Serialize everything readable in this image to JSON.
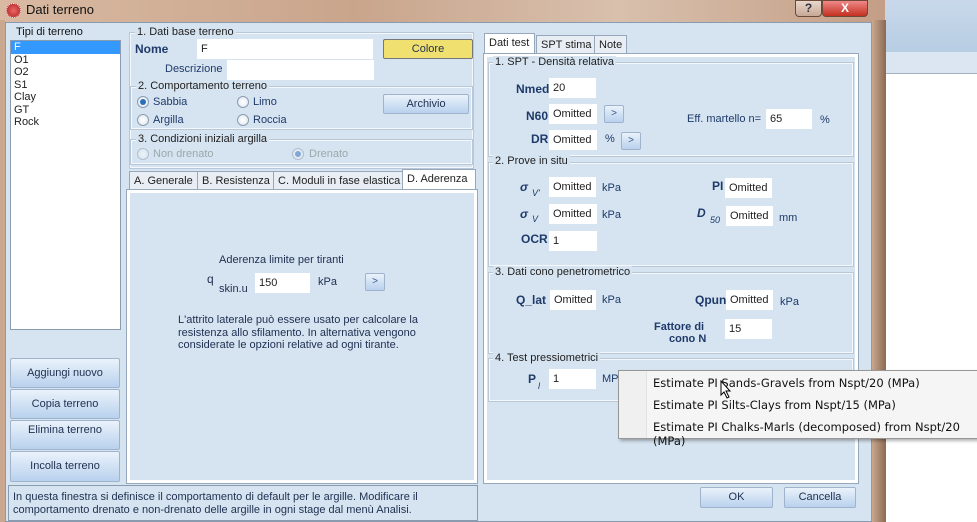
{
  "window": {
    "title": "Dati terreno",
    "help_label": "?",
    "close_label": "X"
  },
  "soil_list": {
    "title": "Tipi di terreno",
    "items": [
      "F",
      "O1",
      "O2",
      "S1",
      "Clay",
      "GT",
      "Rock"
    ],
    "selected": "F"
  },
  "left_buttons": {
    "add": "Aggiungi nuovo",
    "copy": "Copia terreno",
    "delete": "Elimina terreno",
    "paste": "Incolla terreno"
  },
  "base": {
    "title": "1. Dati base terreno",
    "name_label": "Nome",
    "name_value": "F",
    "desc_label": "Descrizione",
    "desc_value": "",
    "color_button": "Colore",
    "color_value": "#f0e070"
  },
  "behavior": {
    "title": "2. Comportamento terreno",
    "options": [
      "Sabbia",
      "Limo",
      "Argilla",
      "Roccia"
    ],
    "selected": "Sabbia",
    "archive_button": "Archivio"
  },
  "clay": {
    "title": "3. Condizioni iniziali argilla",
    "options": [
      "Non drenato",
      "Drenato"
    ],
    "selected": "Drenato"
  },
  "left_tabs": {
    "items": [
      "A. Generale",
      "B. Resistenza",
      "C. Moduli in fase elastica",
      "D. Aderenza"
    ],
    "active": "D. Aderenza"
  },
  "adherence": {
    "title": "Aderenza limite per tiranti",
    "q_label": "q",
    "q_sub": "skin.u",
    "q_value": "150",
    "q_unit": "kPa",
    "arrow_button": ">",
    "note": "L'attrito laterale può essere usato per calcolare la resistenza allo sfilamento. In alternativa vengono considerate le opzioni relative ad ogni tirante."
  },
  "status": "In questa finestra si definisce il comportamento di default per le argille. Modificare il comportamento drenato e non-drenato delle argille in ogni stage dal menù Analisi.",
  "right_tabs": {
    "items": [
      "Dati test",
      "SPT stima",
      "Note"
    ],
    "active": "Dati test"
  },
  "spt": {
    "title": "1. SPT - Densità relativa",
    "nmed_label": "Nmed",
    "nmed_value": "20",
    "n60_label": "N60",
    "n60_value": "Omitted",
    "dr_label": "DR",
    "dr_value": "Omitted",
    "dr_unit": "%",
    "eff_label": "Eff. martello n=",
    "eff_value": "65",
    "eff_unit": "%",
    "arrow": ">"
  },
  "insitu": {
    "title": "2. Prove in situ",
    "sv_label": "σ",
    "sv_sub": "V'",
    "sv_value": "Omitted",
    "sv_unit": "kPa",
    "sv2_label": "σ",
    "sv2_sub": "V",
    "sv2_value": "Omitted",
    "sv2_unit": "kPa",
    "ocr_label": "OCR",
    "ocr_value": "1",
    "pi_label": "PI",
    "pi_value": "Omitted",
    "d50_label": "D",
    "d50_sub": "50",
    "d50_value": "Omitted",
    "d50_unit": "mm"
  },
  "cone": {
    "title": "3. Dati cono penetrometrico",
    "qlat_label": "Q_lat",
    "qlat_value": "Omitted",
    "qlat_unit": "kPa",
    "qpun_label": "Qpun",
    "qpun_value": "Omitted",
    "qpun_unit": "kPa",
    "factor_label_1": "Fattore di",
    "factor_label_2": "cono N",
    "factor_value": "15"
  },
  "pressure": {
    "title": "4. Test pressiometrici",
    "pl_label": "P",
    "pl_sub": "l",
    "pl_value": "1",
    "pl_unit": "MPa"
  },
  "context_menu": {
    "items": [
      "Estimate PI Sands-Gravels from Nspt/20 (MPa)",
      "Estimate PI Silts-Clays from Nspt/15 (MPa)",
      "Estimate PI Chalks-Marls (decomposed) from Nspt/20 (MPa)"
    ]
  },
  "footer": {
    "ok": "OK",
    "cancel": "Cancella"
  }
}
